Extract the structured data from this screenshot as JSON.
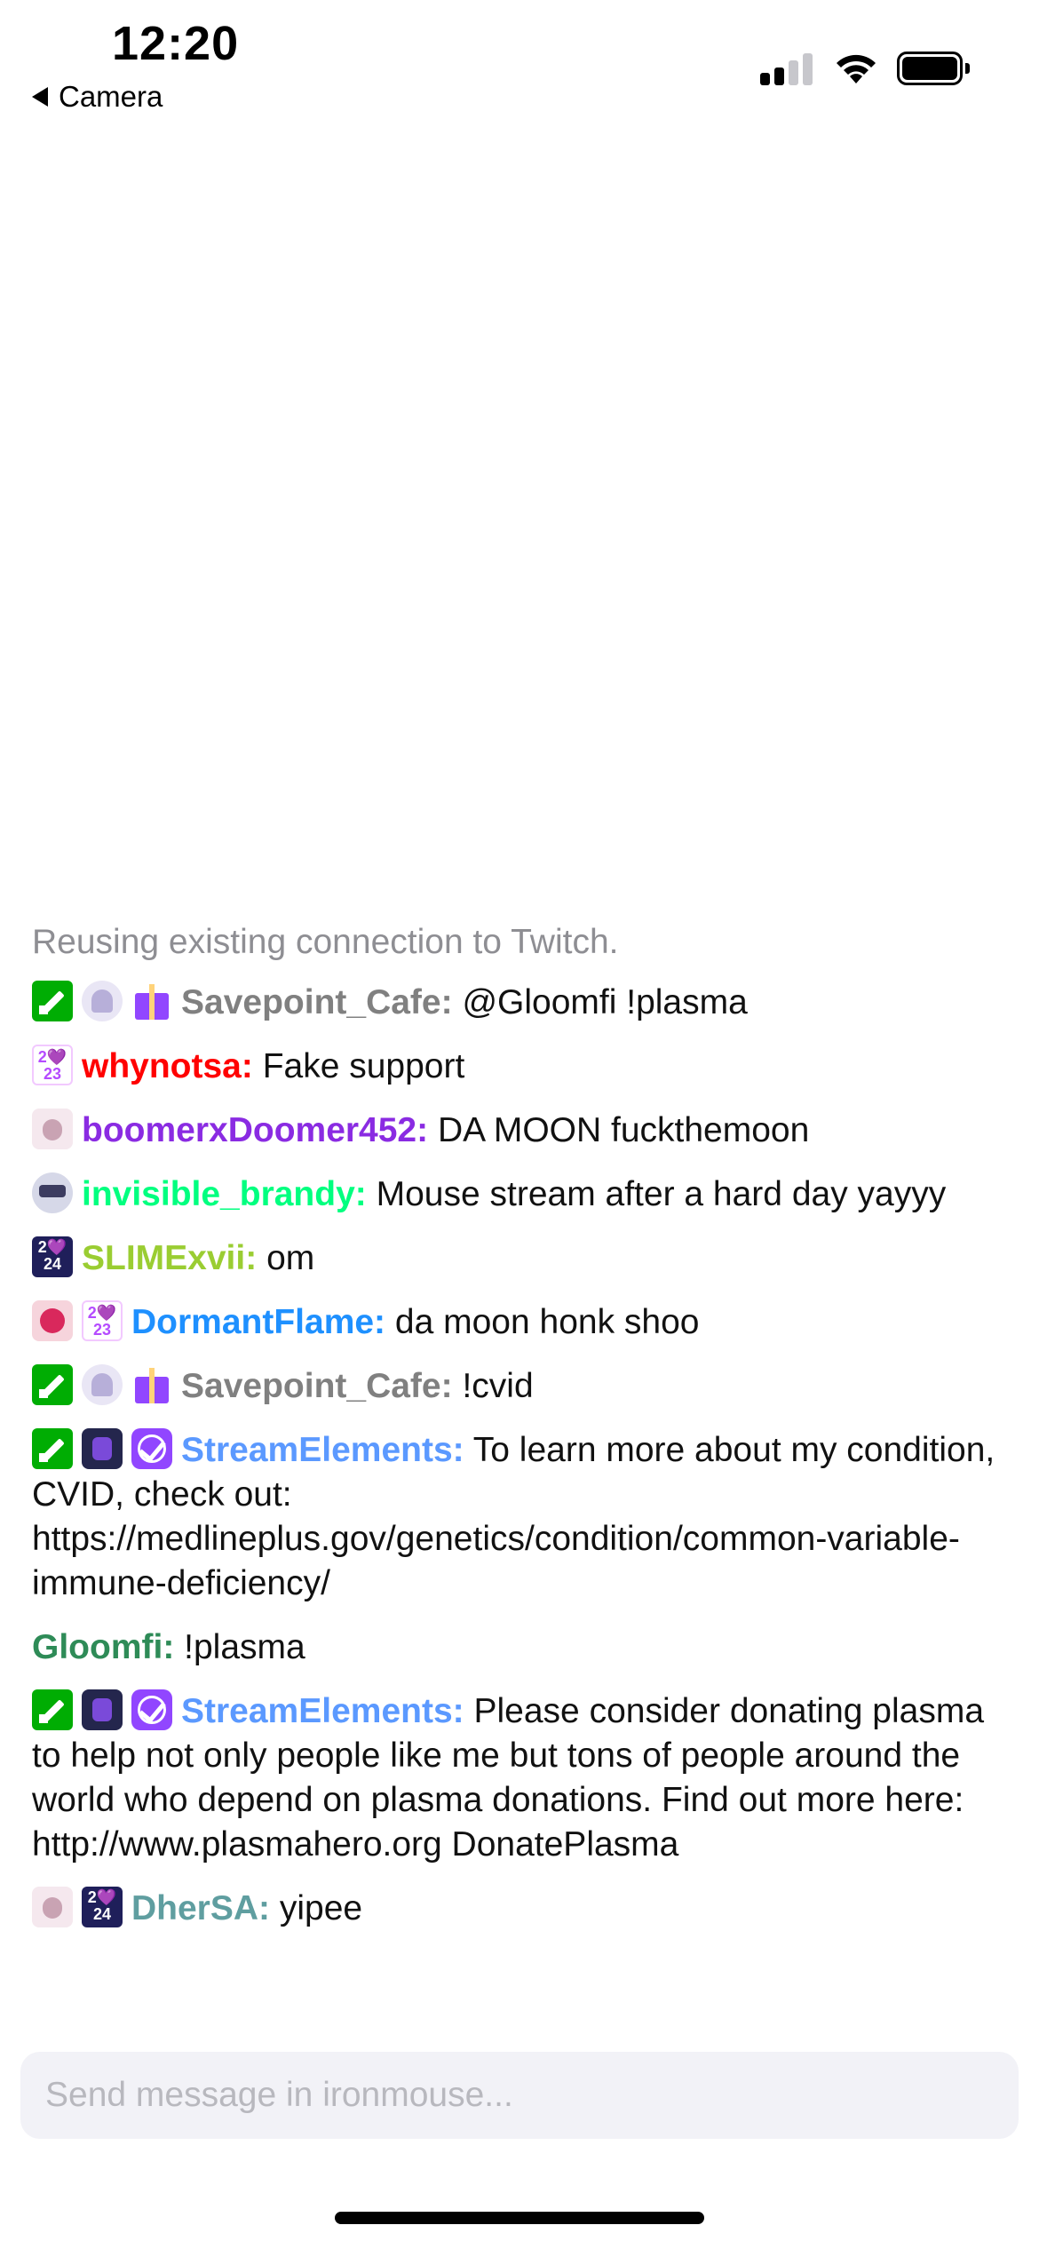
{
  "status_bar": {
    "time": "12:20",
    "back_label": "Camera"
  },
  "chat": {
    "system_message": "Reusing existing connection to Twitch.",
    "messages": [
      {
        "badges": [
          "mod-icon",
          "sub-ghost-icon",
          "gift-icon"
        ],
        "user": "Savepoint_Cafe:",
        "color": "#808080",
        "text": "@Gloomfi !plasma"
      },
      {
        "badges": [
          "2023-badge-icon"
        ],
        "user": "whynotsa:",
        "color": "#ff0000",
        "text": "Fake support"
      },
      {
        "badges": [
          "ears-icon"
        ],
        "user": "boomerxDoomer452:",
        "color": "#8a2be2",
        "text": "DA MOON fuckthemoon"
      },
      {
        "badges": [
          "masked-icon"
        ],
        "user": "invisible_brandy:",
        "color": "#00ff7f",
        "text": "Mouse stream after a hard day yayyy"
      },
      {
        "badges": [
          "2024-badge-icon"
        ],
        "user": "SLIMExvii:",
        "color": "#9acd32",
        "text": "om"
      },
      {
        "badges": [
          "demon-icon",
          "2023-badge-icon"
        ],
        "user": "DormantFlame:",
        "color": "#1e90ff",
        "text": "da moon honk shoo"
      },
      {
        "badges": [
          "mod-icon",
          "sub-ghost-icon",
          "gift-icon"
        ],
        "user": "Savepoint_Cafe:",
        "color": "#808080",
        "text": "!cvid"
      },
      {
        "badges": [
          "mod-icon",
          "knight-icon",
          "verified-icon"
        ],
        "user": "StreamElements:",
        "color": "#5b99ff",
        "text": "To learn more about my condition, CVID, check out: https://medlineplus.gov/genetics/condition/common-variable-immune-deficiency/"
      },
      {
        "badges": [],
        "user": "Gloomfi:",
        "color": "#2e8b57",
        "text": "!plasma"
      },
      {
        "badges": [
          "mod-icon",
          "knight-icon",
          "verified-icon"
        ],
        "user": "StreamElements:",
        "color": "#5b99ff",
        "text": "Please consider donating plasma to help not only people like me but tons of people around the world who depend on plasma donations. Find out more here: http://www.plasmahero.org DonatePlasma"
      },
      {
        "badges": [
          "ears-icon",
          "2024-badge-icon"
        ],
        "user": "DherSA:",
        "color": "#5f9ea0",
        "text": "yipee"
      }
    ]
  },
  "badge_text": {
    "b2023_top": "2💜",
    "b2023_bottom": "23",
    "b2024_top": "2💜",
    "b2024_bottom": "24"
  },
  "input": {
    "placeholder": "Send message in ironmouse..."
  }
}
